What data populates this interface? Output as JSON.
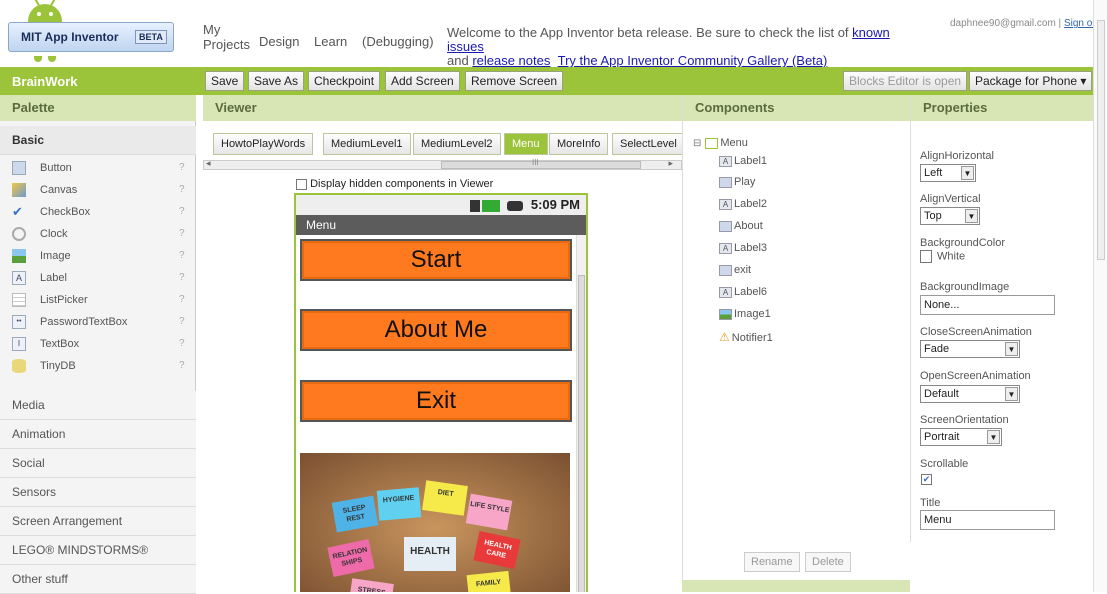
{
  "header": {
    "logo_text": "MIT App Inventor",
    "beta": "BETA",
    "nav": {
      "my_projects": "My Projects",
      "design": "Design",
      "learn": "Learn",
      "debugging": "(Debugging)"
    },
    "welcome_pre": "Welcome to the App Inventor beta release. Be sure to check the list of ",
    "known_issues": "known issues",
    "welcome_and": "and ",
    "release_notes": "release notes",
    "gallery": "Try the App Inventor Community Gallery (Beta)",
    "email": "daphnee90@gmail.com",
    "sep": " | ",
    "sign_out": "Sign out"
  },
  "toolbar": {
    "app_name": "BrainWork",
    "save": "Save",
    "save_as": "Save As",
    "checkpoint": "Checkpoint",
    "add_screen": "Add Screen",
    "remove_screen": "Remove Screen",
    "blocks_editor": "Blocks Editor is open",
    "package": "Package for Phone ▾"
  },
  "palette": {
    "title": "Palette",
    "basic": "Basic",
    "items": [
      {
        "label": "Button",
        "icon": "button-icon"
      },
      {
        "label": "Canvas",
        "icon": "canvas-icon"
      },
      {
        "label": "CheckBox",
        "icon": "checkbox-icon"
      },
      {
        "label": "Clock",
        "icon": "clock-icon"
      },
      {
        "label": "Image",
        "icon": "image-icon"
      },
      {
        "label": "Label",
        "icon": "label-icon"
      },
      {
        "label": "ListPicker",
        "icon": "listpicker-icon"
      },
      {
        "label": "PasswordTextBox",
        "icon": "password-icon"
      },
      {
        "label": "TextBox",
        "icon": "textbox-icon"
      },
      {
        "label": "TinyDB",
        "icon": "tinydb-icon"
      }
    ],
    "help": "?",
    "categories": [
      "Media",
      "Animation",
      "Social",
      "Sensors",
      "Screen Arrangement",
      "LEGO® MINDSTORMS®",
      "Other stuff"
    ]
  },
  "viewer": {
    "title": "Viewer",
    "tabs": [
      "HowtoPlayWords",
      "MediumLevel1",
      "MediumLevel2",
      "Menu",
      "MoreInfo",
      "SelectLevel"
    ],
    "active_tab": "Menu",
    "hscroll_mark": "III",
    "display_hidden": "Display hidden components in Viewer",
    "phone": {
      "time": "5:09 PM",
      "screen_title": "Menu",
      "buttons": [
        "Start",
        "About Me",
        "Exit"
      ],
      "notes": [
        "SLEEP REST",
        "HYGIENE",
        "DIET",
        "LIFE STYLE",
        "RELATION SHIPS",
        "HEALTH",
        "HEALTH CARE",
        "FAMILY",
        "STRESS"
      ]
    }
  },
  "components": {
    "title": "Components",
    "root": "Menu",
    "items": [
      {
        "label": "Label1",
        "type": "label"
      },
      {
        "label": "Play",
        "type": "button"
      },
      {
        "label": "Label2",
        "type": "label"
      },
      {
        "label": "About",
        "type": "button"
      },
      {
        "label": "Label3",
        "type": "label"
      },
      {
        "label": "exit",
        "type": "button"
      },
      {
        "label": "Label6",
        "type": "label"
      },
      {
        "label": "Image1",
        "type": "image"
      },
      {
        "label": "Notifier1",
        "type": "notifier"
      }
    ],
    "rename": "Rename",
    "delete": "Delete"
  },
  "properties": {
    "title": "Properties",
    "align_h_label": "AlignHorizontal",
    "align_h": "Left",
    "align_v_label": "AlignVertical",
    "align_v": "Top",
    "bg_color_label": "BackgroundColor",
    "bg_color": "White",
    "bg_image_label": "BackgroundImage",
    "bg_image": "None...",
    "close_anim_label": "CloseScreenAnimation",
    "close_anim": "Fade",
    "open_anim_label": "OpenScreenAnimation",
    "open_anim": "Default",
    "orientation_label": "ScreenOrientation",
    "orientation": "Portrait",
    "scrollable_label": "Scrollable",
    "scrollable": true,
    "title_label": "Title",
    "title_value": "Menu"
  },
  "colors": {
    "accent": "#9cc43a",
    "panel_head": "#d8e6b6",
    "phone_button": "#ff7a1f"
  }
}
